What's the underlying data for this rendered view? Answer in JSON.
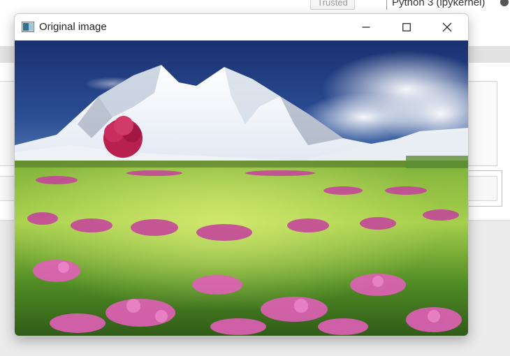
{
  "jupyter": {
    "trusted_label": "Trusted",
    "kernel_name": "Python 3 (ipykernel)"
  },
  "window": {
    "title": "Original image",
    "controls": {
      "minimize": "minimize-icon",
      "maximize": "maximize-icon",
      "close": "close-icon"
    }
  },
  "image": {
    "subject": "landscape-photo"
  }
}
